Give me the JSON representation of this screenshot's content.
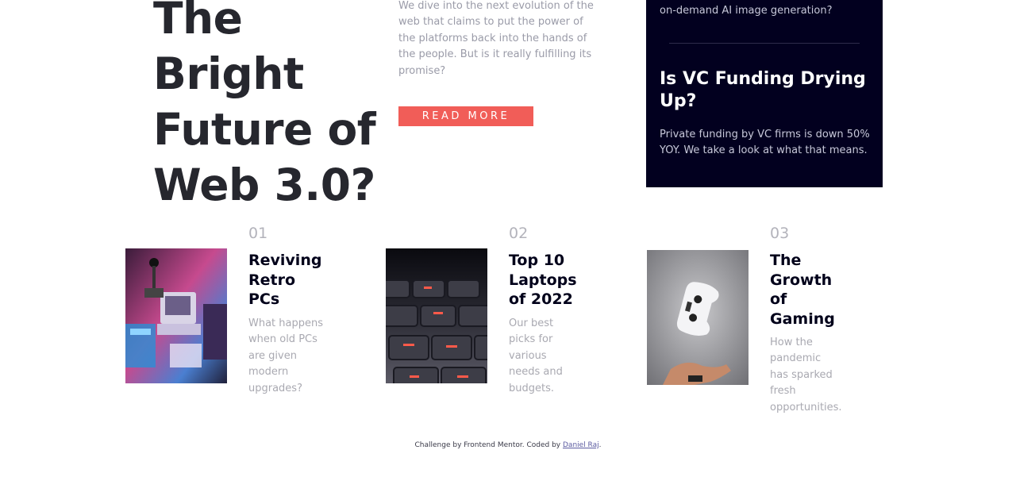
{
  "hero": {
    "title": "The Bright Future of Web 3.0?",
    "description": "We dive into the next evolution of the web that claims to put the power of the platforms back into the hands of the people. But is it really fulfilling its promise?",
    "read_more_label": "READ MORE"
  },
  "sidebar": {
    "top_text": "on-demand AI image generation?",
    "item_title": "Is VC Funding Drying Up?",
    "item_desc": "Private funding by VC firms is down 50% YOY. We take a look at what that means.",
    "background": "#02001f"
  },
  "cards": [
    {
      "number": "01",
      "title": "Reviving Retro PCs",
      "description": "What happens when old PCs are given modern upgrades?",
      "image": "retro-pcs-image"
    },
    {
      "number": "02",
      "title": "Top 10 Laptops of 2022",
      "description": "Our best picks for various needs and budgets.",
      "image": "laptop-keyboard-image"
    },
    {
      "number": "03",
      "title": "The Growth of Gaming",
      "description": "How the pandemic has sparked fresh opportunities.",
      "image": "game-controller-image"
    }
  ],
  "footer": {
    "prefix": "Challenge by Frontend Mentor. Coded by ",
    "author": "Daniel Raj",
    "suffix": "."
  },
  "colors": {
    "accent": "#f15d58",
    "dark": "#00001a",
    "muted": "#9a9ba8"
  }
}
